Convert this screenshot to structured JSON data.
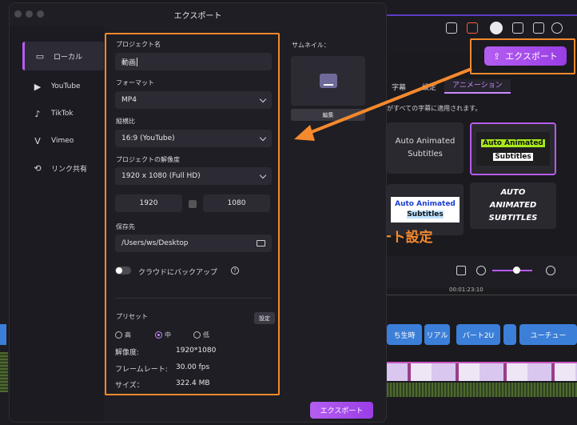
{
  "dialog": {
    "title": "エクスポート",
    "sidebar": [
      {
        "label": "ローカル",
        "icon": "local-icon",
        "active": true
      },
      {
        "label": "YouTube",
        "icon": "youtube-icon"
      },
      {
        "label": "TikTok",
        "icon": "tiktok-icon"
      },
      {
        "label": "Vimeo",
        "icon": "vimeo-icon"
      },
      {
        "label": "リンク共有",
        "icon": "share-link-icon"
      }
    ],
    "project_name_label": "プロジェクト名",
    "project_name_value": "動画",
    "format_label": "フォーマット",
    "format_value": "MP4",
    "aspect_label": "縦横比",
    "aspect_value": "16:9 (YouTube)",
    "resolution_label": "プロジェクトの解像度",
    "resolution_value": "1920 x 1080 (Full HD)",
    "width_value": "1920",
    "height_value": "1080",
    "save_label": "保存先",
    "save_value": "/Users/ws/Desktop",
    "cloud_backup_label": "クラウドにバックアップ",
    "preset_label": "プリセット",
    "settings_button": "設定",
    "quality_options": [
      "高",
      "中",
      "低"
    ],
    "quality_selected": "中",
    "info": [
      {
        "k": "解像度:",
        "v": "1920*1080"
      },
      {
        "k": "フレームレート:",
        "v": "30.00 fps"
      },
      {
        "k": "サイズ：",
        "v": "322.4 MB"
      }
    ],
    "thumbnail_label": "サムネイル：",
    "edit_button": "編集",
    "export_button": "エクスポート"
  },
  "background": {
    "export_button": "エクスポート",
    "tabs": [
      "字幕",
      "設定",
      "アニメーション"
    ],
    "active_tab": "アニメーション",
    "tab_note": "がすべての字幕に適用されます。",
    "presets": [
      "Auto Animated Subtitles",
      "Auto Animated Subtitles",
      "Auto Animated Subtitles",
      "AUTO ANIMATED SUBTITLES"
    ],
    "timecode": "00:01:23:10",
    "clips": [
      "ち生時",
      "リアル",
      "パート2U",
      "ユーチュー"
    ]
  },
  "annotation": "動画エクスポート設定",
  "colors": {
    "accent": "#b65cf0",
    "highlight": "#f5892d"
  }
}
